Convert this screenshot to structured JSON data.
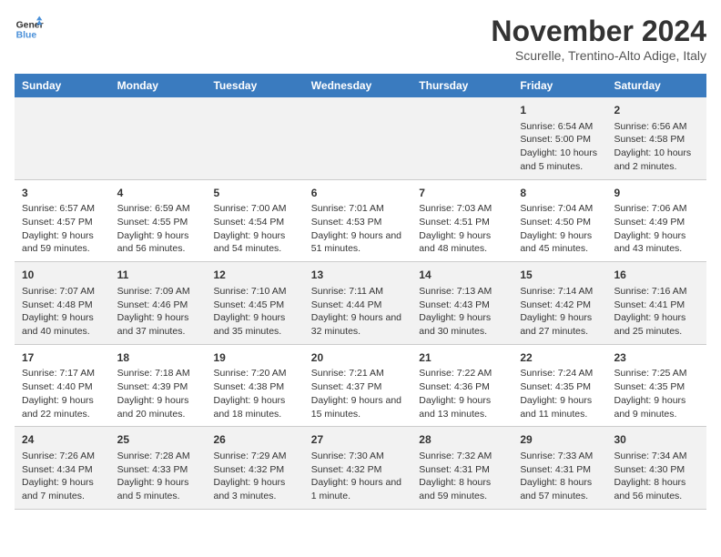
{
  "header": {
    "logo_line1": "General",
    "logo_line2": "Blue",
    "title": "November 2024",
    "subtitle": "Scurelle, Trentino-Alto Adige, Italy"
  },
  "columns": [
    "Sunday",
    "Monday",
    "Tuesday",
    "Wednesday",
    "Thursday",
    "Friday",
    "Saturday"
  ],
  "rows": [
    [
      {
        "day": "",
        "info": ""
      },
      {
        "day": "",
        "info": ""
      },
      {
        "day": "",
        "info": ""
      },
      {
        "day": "",
        "info": ""
      },
      {
        "day": "",
        "info": ""
      },
      {
        "day": "1",
        "info": "Sunrise: 6:54 AM\nSunset: 5:00 PM\nDaylight: 10 hours and 5 minutes."
      },
      {
        "day": "2",
        "info": "Sunrise: 6:56 AM\nSunset: 4:58 PM\nDaylight: 10 hours and 2 minutes."
      }
    ],
    [
      {
        "day": "3",
        "info": "Sunrise: 6:57 AM\nSunset: 4:57 PM\nDaylight: 9 hours and 59 minutes."
      },
      {
        "day": "4",
        "info": "Sunrise: 6:59 AM\nSunset: 4:55 PM\nDaylight: 9 hours and 56 minutes."
      },
      {
        "day": "5",
        "info": "Sunrise: 7:00 AM\nSunset: 4:54 PM\nDaylight: 9 hours and 54 minutes."
      },
      {
        "day": "6",
        "info": "Sunrise: 7:01 AM\nSunset: 4:53 PM\nDaylight: 9 hours and 51 minutes."
      },
      {
        "day": "7",
        "info": "Sunrise: 7:03 AM\nSunset: 4:51 PM\nDaylight: 9 hours and 48 minutes."
      },
      {
        "day": "8",
        "info": "Sunrise: 7:04 AM\nSunset: 4:50 PM\nDaylight: 9 hours and 45 minutes."
      },
      {
        "day": "9",
        "info": "Sunrise: 7:06 AM\nSunset: 4:49 PM\nDaylight: 9 hours and 43 minutes."
      }
    ],
    [
      {
        "day": "10",
        "info": "Sunrise: 7:07 AM\nSunset: 4:48 PM\nDaylight: 9 hours and 40 minutes."
      },
      {
        "day": "11",
        "info": "Sunrise: 7:09 AM\nSunset: 4:46 PM\nDaylight: 9 hours and 37 minutes."
      },
      {
        "day": "12",
        "info": "Sunrise: 7:10 AM\nSunset: 4:45 PM\nDaylight: 9 hours and 35 minutes."
      },
      {
        "day": "13",
        "info": "Sunrise: 7:11 AM\nSunset: 4:44 PM\nDaylight: 9 hours and 32 minutes."
      },
      {
        "day": "14",
        "info": "Sunrise: 7:13 AM\nSunset: 4:43 PM\nDaylight: 9 hours and 30 minutes."
      },
      {
        "day": "15",
        "info": "Sunrise: 7:14 AM\nSunset: 4:42 PM\nDaylight: 9 hours and 27 minutes."
      },
      {
        "day": "16",
        "info": "Sunrise: 7:16 AM\nSunset: 4:41 PM\nDaylight: 9 hours and 25 minutes."
      }
    ],
    [
      {
        "day": "17",
        "info": "Sunrise: 7:17 AM\nSunset: 4:40 PM\nDaylight: 9 hours and 22 minutes."
      },
      {
        "day": "18",
        "info": "Sunrise: 7:18 AM\nSunset: 4:39 PM\nDaylight: 9 hours and 20 minutes."
      },
      {
        "day": "19",
        "info": "Sunrise: 7:20 AM\nSunset: 4:38 PM\nDaylight: 9 hours and 18 minutes."
      },
      {
        "day": "20",
        "info": "Sunrise: 7:21 AM\nSunset: 4:37 PM\nDaylight: 9 hours and 15 minutes."
      },
      {
        "day": "21",
        "info": "Sunrise: 7:22 AM\nSunset: 4:36 PM\nDaylight: 9 hours and 13 minutes."
      },
      {
        "day": "22",
        "info": "Sunrise: 7:24 AM\nSunset: 4:35 PM\nDaylight: 9 hours and 11 minutes."
      },
      {
        "day": "23",
        "info": "Sunrise: 7:25 AM\nSunset: 4:35 PM\nDaylight: 9 hours and 9 minutes."
      }
    ],
    [
      {
        "day": "24",
        "info": "Sunrise: 7:26 AM\nSunset: 4:34 PM\nDaylight: 9 hours and 7 minutes."
      },
      {
        "day": "25",
        "info": "Sunrise: 7:28 AM\nSunset: 4:33 PM\nDaylight: 9 hours and 5 minutes."
      },
      {
        "day": "26",
        "info": "Sunrise: 7:29 AM\nSunset: 4:32 PM\nDaylight: 9 hours and 3 minutes."
      },
      {
        "day": "27",
        "info": "Sunrise: 7:30 AM\nSunset: 4:32 PM\nDaylight: 9 hours and 1 minute."
      },
      {
        "day": "28",
        "info": "Sunrise: 7:32 AM\nSunset: 4:31 PM\nDaylight: 8 hours and 59 minutes."
      },
      {
        "day": "29",
        "info": "Sunrise: 7:33 AM\nSunset: 4:31 PM\nDaylight: 8 hours and 57 minutes."
      },
      {
        "day": "30",
        "info": "Sunrise: 7:34 AM\nSunset: 4:30 PM\nDaylight: 8 hours and 56 minutes."
      }
    ]
  ]
}
